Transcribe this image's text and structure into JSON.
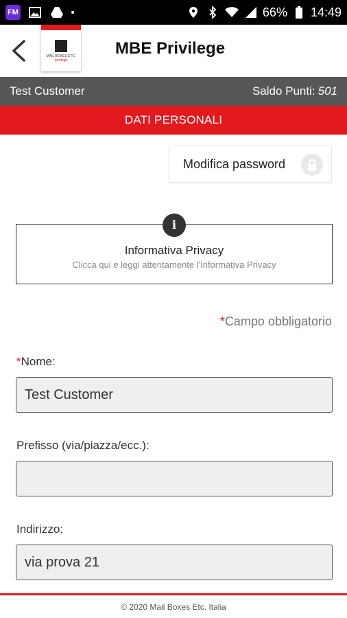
{
  "status_bar": {
    "battery": "66%",
    "time": "14:49"
  },
  "app_bar": {
    "title": "MBE Privilege"
  },
  "customer_bar": {
    "name": "Test Customer",
    "points_label": "Saldo Punti:",
    "points_value": "501"
  },
  "section": {
    "title": "DATI PERSONALI"
  },
  "password_button": {
    "label": "Modifica password"
  },
  "privacy": {
    "title": "Informativa Privacy",
    "subtitle": "Clicca qui e leggi attentamente l'Informativa Privacy",
    "info_glyph": "i"
  },
  "required_note": {
    "star": "*",
    "text": "Campo obbligatorio"
  },
  "fields": [
    {
      "label": "Nome:",
      "required": true,
      "value": "Test Customer"
    },
    {
      "label": "Prefisso (via/piazza/ecc.):",
      "required": false,
      "value": ""
    },
    {
      "label": "Indirizzo:",
      "required": false,
      "value": "via prova 21"
    }
  ],
  "footer": {
    "text": "© 2020 Mail Boxes Etc. Italia"
  },
  "colors": {
    "accent_red": "#e2191e",
    "customer_bar_gray": "#565656"
  }
}
